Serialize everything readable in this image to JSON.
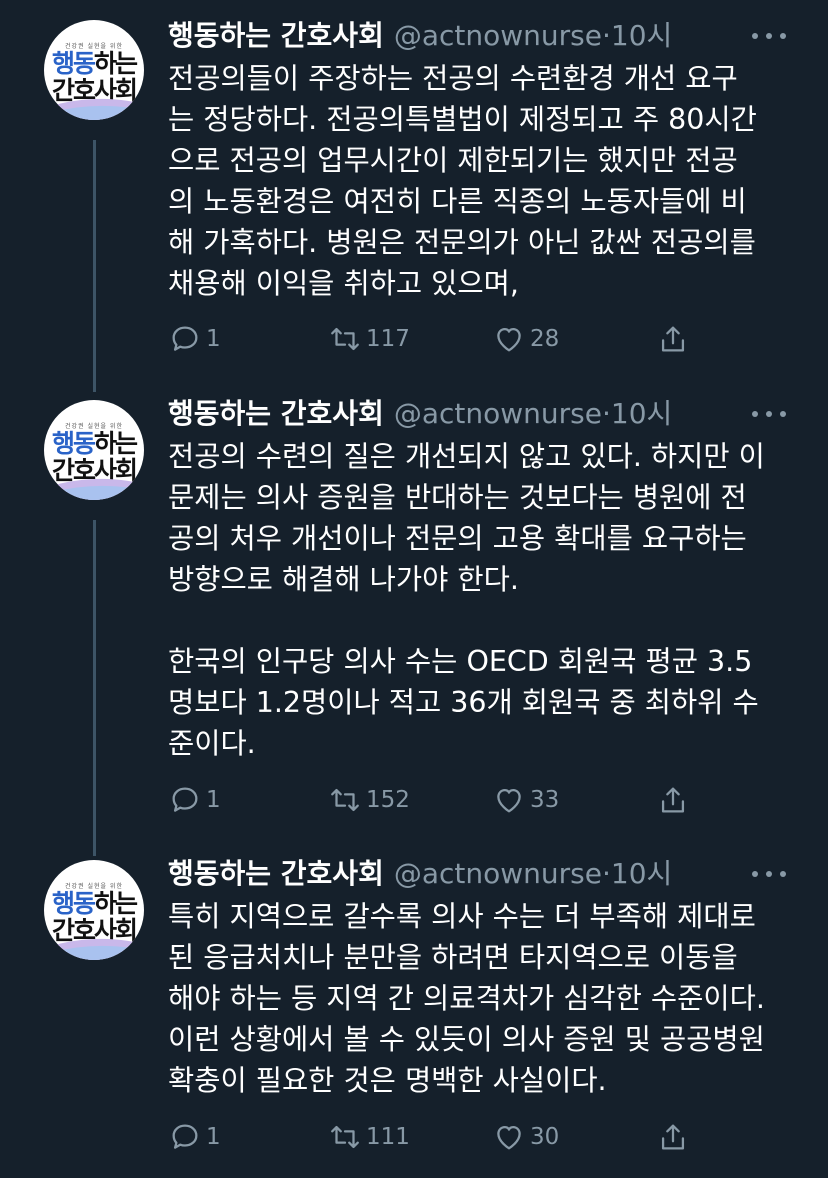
{
  "tweets": [
    {
      "account": {
        "name": "행동하는 간호사회",
        "handle": "@actnownurse",
        "separator": "·",
        "time": "10시"
      },
      "avatar": {
        "small_text": "건강권 실현을 위한",
        "line1_blue": "행동",
        "line1_dark": "하는",
        "line2": "간호사회"
      },
      "lines": [
        "전공의들이 주장하는 전공의 수련환경 개선 요구",
        "는 정당하다. 전공의특별법이 제정되고 주 80시간",
        "으로 전공의 업무시간이 제한되기는 했지만 전공",
        "의 노동환경은 여전히 다른 직종의 노동자들에 비",
        "해 가혹하다. 병원은 전문의가 아닌 값싼 전공의를",
        "채용해 이익을 취하고 있으며,"
      ],
      "stats": {
        "replies": "1",
        "retweets": "117",
        "likes": "28"
      }
    },
    {
      "account": {
        "name": "행동하는 간호사회",
        "handle": "@actnownurse",
        "separator": "·",
        "time": "10시"
      },
      "avatar": {
        "small_text": "건강권 실현을 위한",
        "line1_blue": "행동",
        "line1_dark": "하는",
        "line2": "간호사회"
      },
      "lines": [
        "전공의 수련의 질은 개선되지 않고 있다. 하지만 이",
        "문제는 의사 증원을 반대하는 것보다는 병원에 전",
        "공의 처우 개선이나 전문의 고용 확대를 요구하는",
        "방향으로 해결해 나가야 한다.",
        "",
        "한국의 인구당 의사 수는 OECD 회원국 평균 3.5",
        "명보다 1.2명이나 적고 36개 회원국 중 최하위 수",
        "준이다."
      ],
      "stats": {
        "replies": "1",
        "retweets": "152",
        "likes": "33"
      }
    },
    {
      "account": {
        "name": "행동하는 간호사회",
        "handle": "@actnownurse",
        "separator": "·",
        "time": "10시"
      },
      "avatar": {
        "small_text": "건강권 실현을 위한",
        "line1_blue": "행동",
        "line1_dark": "하는",
        "line2": "간호사회"
      },
      "lines": [
        "특히 지역으로 갈수록 의사 수는 더 부족해 제대로",
        "된 응급처치나 분만을 하려면 타지역으로 이동을",
        "해야 하는 등 지역 간 의료격차가 심각한 수준이다.",
        "이런 상황에서 볼 수 있듯이 의사 증원 및 공공병원",
        "확충이 필요한 것은 명백한 사실이다."
      ],
      "stats": {
        "replies": "1",
        "retweets": "111",
        "likes": "30"
      }
    }
  ],
  "colors": {
    "background": "#15202b",
    "secondary_text": "#8899a6",
    "thread_line": "#3d5466",
    "logo_blue": "#2a63c8"
  },
  "icons": [
    "reply-icon",
    "retweet-icon",
    "like-icon",
    "share-icon",
    "more-icon"
  ]
}
